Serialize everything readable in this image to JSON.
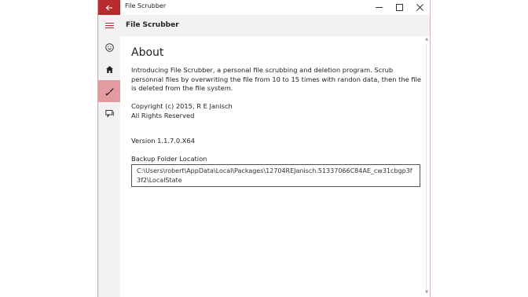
{
  "window": {
    "title": "File Scrubber",
    "controls": {
      "minimize": "—",
      "maximize": "☐",
      "close": "✕"
    }
  },
  "header": {
    "title": "File Scrubber"
  },
  "sidebar": {
    "items": [
      {
        "name": "about",
        "icon": "smiley-icon"
      },
      {
        "name": "home",
        "icon": "home-icon"
      },
      {
        "name": "scrub",
        "icon": "brush-icon",
        "active": true
      },
      {
        "name": "feedback",
        "icon": "feedback-icon"
      }
    ]
  },
  "about": {
    "heading": "About",
    "intro": "Introducing File Scrubber, a personal file scrubbing and deletion program.  Scrub personnal files by overwriting the file from 10 to 15 times with randon data, then the file is deleted from the file system.",
    "copyright": "Copyright (c) 2015, R E Janisch",
    "rights": "All Rights Reserved",
    "version": "Version 1.1.7.0.X64",
    "backup_label": "Backup Folder Location",
    "backup_path": "C:\\Users\\robert\\AppData\\Local\\Packages\\12704REJanisch.51337066C84AE_cw31cbgp3f3f2\\LocalState"
  },
  "colors": {
    "accent": "#b82a2e",
    "active_nav": "#e39aa0",
    "chrome": "#f2f2f2"
  }
}
